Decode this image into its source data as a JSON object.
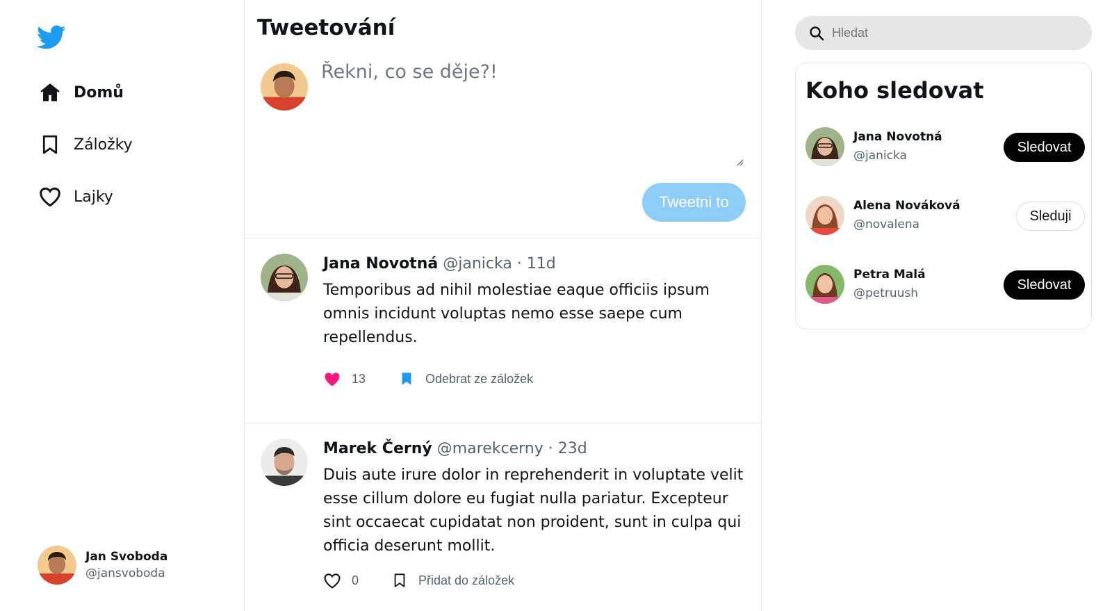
{
  "app": {
    "accent": "#1d9bf0",
    "like_color": "#f91880"
  },
  "sidebar": {
    "logo_icon": "twitter-bird-icon",
    "nav": [
      {
        "label": "Domů",
        "icon": "home-icon",
        "active": true
      },
      {
        "label": "Záložky",
        "icon": "bookmark-icon",
        "active": false
      },
      {
        "label": "Lajky",
        "icon": "heart-icon",
        "active": false
      }
    ],
    "current_user": {
      "name": "Jan Svoboda",
      "handle": "@jansvoboda"
    }
  },
  "compose": {
    "title": "Tweetování",
    "placeholder": "Řekni, co se děje?!",
    "submit_label": "Tweetni to",
    "submit_color": "#8ecdf7"
  },
  "feed": [
    {
      "name": "Jana Novotná",
      "handle": "@janicka",
      "age": "11d",
      "text": "Temporibus ad nihil molestiae eaque officiis ipsum omnis incidunt voluptas nemo esse saepe cum repellendus.",
      "likes": "13",
      "liked": true,
      "bookmark_label": "Odebrat ze záložek",
      "bookmarked": true
    },
    {
      "name": "Marek Černý",
      "handle": "@marekcerny",
      "age": "23d",
      "text": "Duis aute irure dolor in reprehenderit in voluptate velit esse cillum dolore eu fugiat nulla pariatur. Excepteur sint occaecat cupidatat non proident, sunt in culpa qui officia deserunt mollit.",
      "likes": "0",
      "liked": false,
      "bookmark_label": "Přidat do záložek",
      "bookmarked": false
    }
  ],
  "search": {
    "placeholder": "Hledat"
  },
  "who_to_follow": {
    "title": "Koho sledovat",
    "users": [
      {
        "name": "Jana Novotná",
        "handle": "@janicka",
        "button": "Sledovat",
        "following": false
      },
      {
        "name": "Alena Nováková",
        "handle": "@novalena",
        "button": "Sleduji",
        "following": true
      },
      {
        "name": "Petra Malá",
        "handle": "@petruush",
        "button": "Sledovat",
        "following": false
      }
    ]
  }
}
